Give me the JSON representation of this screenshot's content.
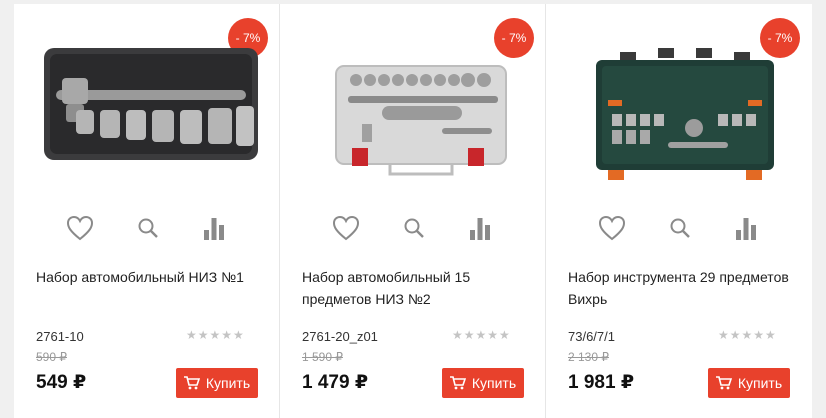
{
  "colors": {
    "accent": "#e8412c",
    "icon": "#8a8a8a"
  },
  "icons": {
    "favorite": "heart-icon",
    "quickview": "search-icon",
    "compare": "bar-chart-icon",
    "cart": "cart-icon"
  },
  "products": [
    {
      "discount": "- 7%",
      "title": "Набор автомобильный НИЗ №1",
      "sku": "2761-10",
      "rating": "★★★★★",
      "old_price": "590 ₽",
      "price": "549 ₽",
      "buy_label": "Купить"
    },
    {
      "discount": "- 7%",
      "title": "Набор автомобильный 15 предметов НИЗ №2",
      "sku": "2761-20_z01",
      "rating": "★★★★★",
      "old_price": "1 590 ₽",
      "price": "1 479 ₽",
      "buy_label": "Купить"
    },
    {
      "discount": "- 7%",
      "title": "Набор инструмента 29 предметов Вихрь",
      "sku": "73/6/7/1",
      "rating": "★★★★★",
      "old_price": "2 130 ₽",
      "price": "1 981 ₽",
      "buy_label": "Купить"
    }
  ]
}
